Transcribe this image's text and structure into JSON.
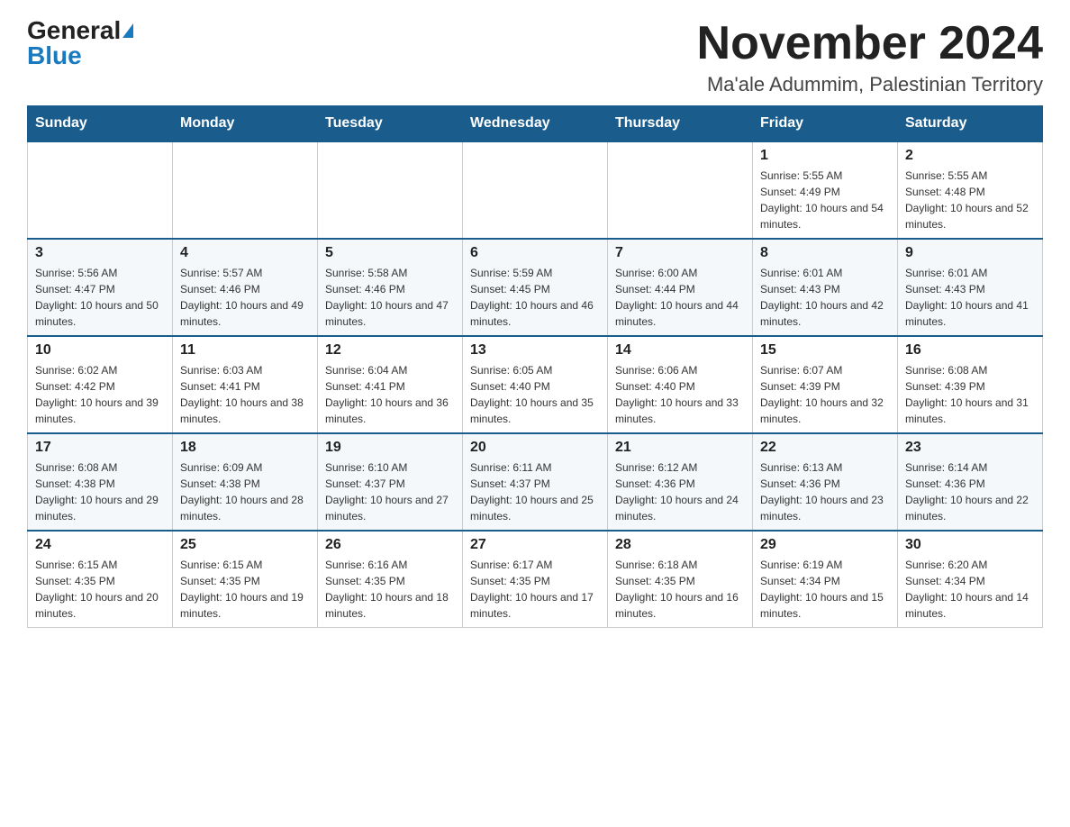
{
  "header": {
    "logo_general": "General",
    "logo_blue": "Blue",
    "month_title": "November 2024",
    "location": "Ma'ale Adummim, Palestinian Territory"
  },
  "days_of_week": [
    "Sunday",
    "Monday",
    "Tuesday",
    "Wednesday",
    "Thursday",
    "Friday",
    "Saturday"
  ],
  "weeks": [
    {
      "days": [
        {
          "date": "",
          "info": ""
        },
        {
          "date": "",
          "info": ""
        },
        {
          "date": "",
          "info": ""
        },
        {
          "date": "",
          "info": ""
        },
        {
          "date": "",
          "info": ""
        },
        {
          "date": "1",
          "info": "Sunrise: 5:55 AM\nSunset: 4:49 PM\nDaylight: 10 hours and 54 minutes."
        },
        {
          "date": "2",
          "info": "Sunrise: 5:55 AM\nSunset: 4:48 PM\nDaylight: 10 hours and 52 minutes."
        }
      ]
    },
    {
      "days": [
        {
          "date": "3",
          "info": "Sunrise: 5:56 AM\nSunset: 4:47 PM\nDaylight: 10 hours and 50 minutes."
        },
        {
          "date": "4",
          "info": "Sunrise: 5:57 AM\nSunset: 4:46 PM\nDaylight: 10 hours and 49 minutes."
        },
        {
          "date": "5",
          "info": "Sunrise: 5:58 AM\nSunset: 4:46 PM\nDaylight: 10 hours and 47 minutes."
        },
        {
          "date": "6",
          "info": "Sunrise: 5:59 AM\nSunset: 4:45 PM\nDaylight: 10 hours and 46 minutes."
        },
        {
          "date": "7",
          "info": "Sunrise: 6:00 AM\nSunset: 4:44 PM\nDaylight: 10 hours and 44 minutes."
        },
        {
          "date": "8",
          "info": "Sunrise: 6:01 AM\nSunset: 4:43 PM\nDaylight: 10 hours and 42 minutes."
        },
        {
          "date": "9",
          "info": "Sunrise: 6:01 AM\nSunset: 4:43 PM\nDaylight: 10 hours and 41 minutes."
        }
      ]
    },
    {
      "days": [
        {
          "date": "10",
          "info": "Sunrise: 6:02 AM\nSunset: 4:42 PM\nDaylight: 10 hours and 39 minutes."
        },
        {
          "date": "11",
          "info": "Sunrise: 6:03 AM\nSunset: 4:41 PM\nDaylight: 10 hours and 38 minutes."
        },
        {
          "date": "12",
          "info": "Sunrise: 6:04 AM\nSunset: 4:41 PM\nDaylight: 10 hours and 36 minutes."
        },
        {
          "date": "13",
          "info": "Sunrise: 6:05 AM\nSunset: 4:40 PM\nDaylight: 10 hours and 35 minutes."
        },
        {
          "date": "14",
          "info": "Sunrise: 6:06 AM\nSunset: 4:40 PM\nDaylight: 10 hours and 33 minutes."
        },
        {
          "date": "15",
          "info": "Sunrise: 6:07 AM\nSunset: 4:39 PM\nDaylight: 10 hours and 32 minutes."
        },
        {
          "date": "16",
          "info": "Sunrise: 6:08 AM\nSunset: 4:39 PM\nDaylight: 10 hours and 31 minutes."
        }
      ]
    },
    {
      "days": [
        {
          "date": "17",
          "info": "Sunrise: 6:08 AM\nSunset: 4:38 PM\nDaylight: 10 hours and 29 minutes."
        },
        {
          "date": "18",
          "info": "Sunrise: 6:09 AM\nSunset: 4:38 PM\nDaylight: 10 hours and 28 minutes."
        },
        {
          "date": "19",
          "info": "Sunrise: 6:10 AM\nSunset: 4:37 PM\nDaylight: 10 hours and 27 minutes."
        },
        {
          "date": "20",
          "info": "Sunrise: 6:11 AM\nSunset: 4:37 PM\nDaylight: 10 hours and 25 minutes."
        },
        {
          "date": "21",
          "info": "Sunrise: 6:12 AM\nSunset: 4:36 PM\nDaylight: 10 hours and 24 minutes."
        },
        {
          "date": "22",
          "info": "Sunrise: 6:13 AM\nSunset: 4:36 PM\nDaylight: 10 hours and 23 minutes."
        },
        {
          "date": "23",
          "info": "Sunrise: 6:14 AM\nSunset: 4:36 PM\nDaylight: 10 hours and 22 minutes."
        }
      ]
    },
    {
      "days": [
        {
          "date": "24",
          "info": "Sunrise: 6:15 AM\nSunset: 4:35 PM\nDaylight: 10 hours and 20 minutes."
        },
        {
          "date": "25",
          "info": "Sunrise: 6:15 AM\nSunset: 4:35 PM\nDaylight: 10 hours and 19 minutes."
        },
        {
          "date": "26",
          "info": "Sunrise: 6:16 AM\nSunset: 4:35 PM\nDaylight: 10 hours and 18 minutes."
        },
        {
          "date": "27",
          "info": "Sunrise: 6:17 AM\nSunset: 4:35 PM\nDaylight: 10 hours and 17 minutes."
        },
        {
          "date": "28",
          "info": "Sunrise: 6:18 AM\nSunset: 4:35 PM\nDaylight: 10 hours and 16 minutes."
        },
        {
          "date": "29",
          "info": "Sunrise: 6:19 AM\nSunset: 4:34 PM\nDaylight: 10 hours and 15 minutes."
        },
        {
          "date": "30",
          "info": "Sunrise: 6:20 AM\nSunset: 4:34 PM\nDaylight: 10 hours and 14 minutes."
        }
      ]
    }
  ]
}
